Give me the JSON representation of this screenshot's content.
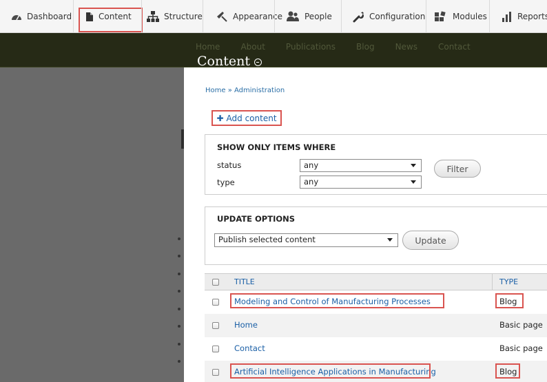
{
  "toolbar": {
    "items": [
      {
        "label": "Dashboard",
        "icon": "dashboard-icon"
      },
      {
        "label": "Content",
        "icon": "content-icon",
        "active": true
      },
      {
        "label": "Structure",
        "icon": "structure-icon"
      },
      {
        "label": "Appearance",
        "icon": "appearance-icon"
      },
      {
        "label": "People",
        "icon": "people-icon"
      },
      {
        "label": "Configuration",
        "icon": "configuration-icon"
      },
      {
        "label": "Modules",
        "icon": "modules-icon"
      },
      {
        "label": "Reports",
        "icon": "reports-icon"
      }
    ]
  },
  "site_nav": [
    "Home",
    "About",
    "Publications",
    "Blog",
    "News",
    "Contact"
  ],
  "page": {
    "title": "Content",
    "breadcrumb": "Home » Administration",
    "add_content": "Add content"
  },
  "filter": {
    "legend": "SHOW ONLY ITEMS WHERE",
    "status_label": "status",
    "status_value": "any",
    "type_label": "type",
    "type_value": "any",
    "button": "Filter"
  },
  "update": {
    "legend": "UPDATE OPTIONS",
    "action_value": "Publish selected content",
    "button": "Update"
  },
  "table": {
    "headers": {
      "title": "TITLE",
      "type": "TYPE"
    },
    "rows": [
      {
        "title": "Modeling and Control of Manufacturing Processes",
        "type": "Blog"
      },
      {
        "title": "Home",
        "type": "Basic page"
      },
      {
        "title": "Contact",
        "type": "Basic page"
      },
      {
        "title": "Artificial Intelligence Applications in Manufacturing",
        "type": "Blog"
      }
    ]
  },
  "colors": {
    "highlight": "#d9534f",
    "link": "#1a5fa6",
    "header_dark": "#262a16"
  }
}
